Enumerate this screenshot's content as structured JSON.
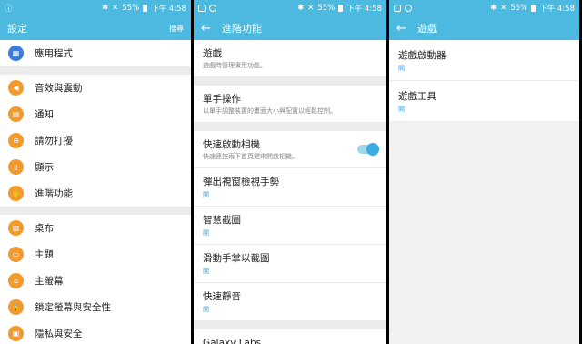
{
  "status": {
    "left": "ⓘ",
    "battery": "55%",
    "time": "下午 4:58"
  },
  "panel1": {
    "title": "設定",
    "search": "搜尋",
    "groups": [
      [
        {
          "label": "應用程式",
          "icon": "apps-icon",
          "color": "#3b7ddd",
          "glyph": "▦"
        }
      ],
      [
        {
          "label": "音效與震動",
          "icon": "sound-icon",
          "color": "#f39a2e",
          "glyph": "◀"
        },
        {
          "label": "通知",
          "icon": "notification-icon",
          "color": "#f39a2e",
          "glyph": "▤"
        },
        {
          "label": "請勿打擾",
          "icon": "do-not-disturb-icon",
          "color": "#f39a2e",
          "glyph": "⊖"
        },
        {
          "label": "顯示",
          "icon": "display-icon",
          "color": "#f39a2e",
          "glyph": "▯"
        },
        {
          "label": "進階功能",
          "icon": "advanced-features-icon",
          "color": "#f39a2e",
          "glyph": "✋"
        }
      ],
      [
        {
          "label": "桌布",
          "icon": "wallpaper-icon",
          "color": "#f39a2e",
          "glyph": "▨"
        },
        {
          "label": "主題",
          "icon": "themes-icon",
          "color": "#f39a2e",
          "glyph": "▭"
        },
        {
          "label": "主螢幕",
          "icon": "home-screen-icon",
          "color": "#f39a2e",
          "glyph": "⌂"
        },
        {
          "label": "鎖定螢幕與安全性",
          "icon": "lock-icon",
          "color": "#f39a2e",
          "glyph": "🔒"
        },
        {
          "label": "隱私與安全",
          "icon": "privacy-icon",
          "color": "#f39a2e",
          "glyph": "▣"
        }
      ]
    ]
  },
  "panel2": {
    "title": "進階功能",
    "groups": [
      [
        {
          "title": "遊戲",
          "sub": "遊戲時管理實用功能。"
        }
      ],
      [
        {
          "title": "單手操作",
          "sub": "以單手調整裝置的畫面大小與配置以輕鬆控制。"
        }
      ],
      [
        {
          "title": "快速啟動相機",
          "sub": "快速連按兩下首頁鍵來開啟相機。",
          "toggle": true
        },
        {
          "title": "彈出視窗檢視手勢",
          "value": "開"
        },
        {
          "title": "智慧截圖",
          "value": "開"
        },
        {
          "title": "滑動手掌以截圖",
          "value": "開"
        },
        {
          "title": "快速靜音",
          "value": "開"
        }
      ],
      [
        {
          "title": "Galaxy Labs"
        }
      ]
    ]
  },
  "panel3": {
    "title": "遊戲",
    "items": [
      {
        "title": "遊戲啟動器",
        "value": "開"
      },
      {
        "title": "遊戲工具",
        "value": "開"
      }
    ]
  }
}
